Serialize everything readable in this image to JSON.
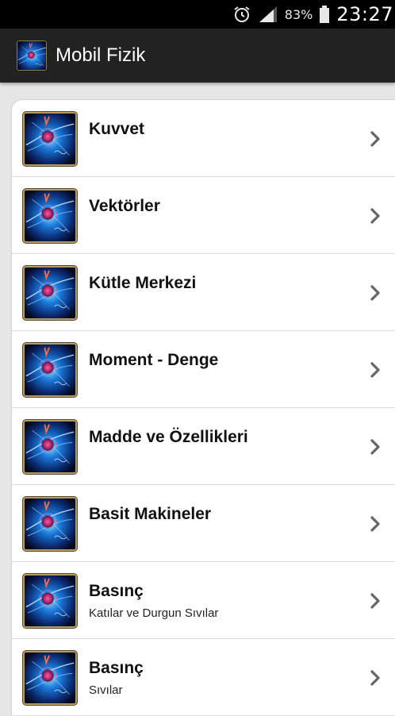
{
  "status_bar": {
    "battery_percent": "83%",
    "time": "23:27",
    "icons": [
      "alarm-icon",
      "signal-icon",
      "battery-icon"
    ]
  },
  "action_bar": {
    "app_title": "Mobil Fizik",
    "app_icon": "app-logo-icon"
  },
  "list": {
    "items": [
      {
        "title": "Kuvvet",
        "subtitle": ""
      },
      {
        "title": "Vektörler",
        "subtitle": ""
      },
      {
        "title": "Kütle Merkezi",
        "subtitle": ""
      },
      {
        "title": "Moment - Denge",
        "subtitle": ""
      },
      {
        "title": "Madde ve Özellikleri",
        "subtitle": ""
      },
      {
        "title": "Basit Makineler",
        "subtitle": ""
      },
      {
        "title": "Basınç",
        "subtitle": "Katılar ve Durgun Sıvılar"
      },
      {
        "title": "Basınç",
        "subtitle": "Sıvılar"
      }
    ],
    "thumbnail_icon": "physics-thumbnail-icon",
    "chevron_icon": "chevron-right-icon"
  },
  "colors": {
    "status_bar_bg": "#000000",
    "action_bar_bg": "#222222",
    "page_bg": "#e6e6e6",
    "card_bg": "#ffffff",
    "thumb_border": "#b89a63"
  }
}
